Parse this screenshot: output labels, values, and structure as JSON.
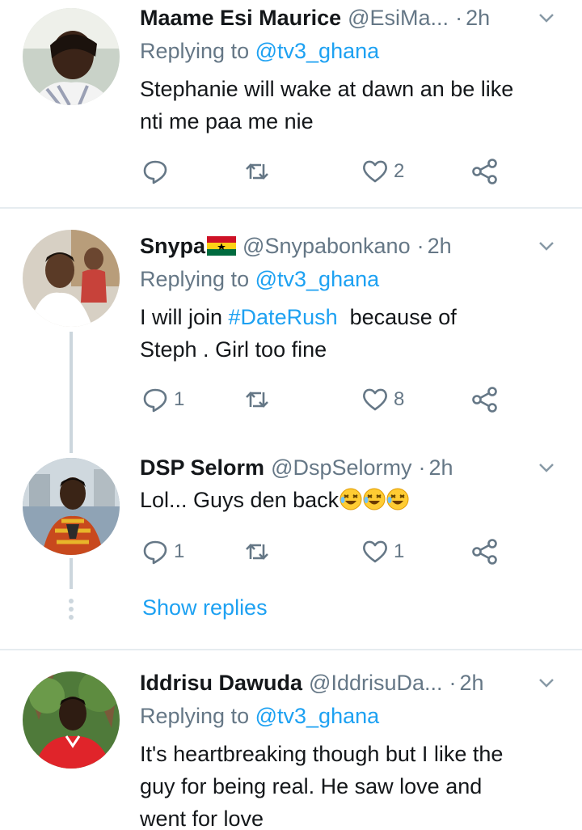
{
  "tweets": [
    {
      "name": "Maame Esi Maurice",
      "handle": "@EsiMa...",
      "time": "2h",
      "replying_prefix": "Replying to",
      "replying_to": "@tv3_ghana",
      "text_lines": [
        "Stephanie will wake at dawn an be like",
        "nti me paa me nie"
      ],
      "replies": "",
      "retweets": "",
      "likes": "2"
    },
    {
      "name": "Snypa",
      "flag_icon": "ghana-flag-icon",
      "handle": "@Snypabonkano",
      "time": "2h",
      "replying_prefix": "Replying to",
      "replying_to": "@tv3_ghana",
      "text_prefix": "I will join ",
      "hashtag": "#DateRush",
      "text_suffix": "  because of",
      "text_line2": "Steph . Girl too fine",
      "replies": "1",
      "retweets": "",
      "likes": "8"
    },
    {
      "name": "DSP Selorm",
      "handle": "@DspSelormy",
      "time": "2h",
      "text": "Lol... Guys den back",
      "emoji": "rolling-on-floor-laughing-emoji",
      "replies": "1",
      "retweets": "",
      "likes": "1"
    },
    {
      "name": "Iddrisu Dawuda",
      "handle": "@IddrisuDa...",
      "time": "2h",
      "replying_prefix": "Replying to",
      "replying_to": "@tv3_ghana",
      "text_lines": [
        "It's heartbreaking though but I like the",
        "guy for being real. He saw love and",
        "went for love"
      ]
    }
  ],
  "show_replies": "Show replies",
  "separator": "·",
  "colors": {
    "link": "#1da1f2",
    "muted": "#657786",
    "text": "#14171a",
    "divider": "#e6ecf0",
    "thread": "#ccd6dd"
  }
}
